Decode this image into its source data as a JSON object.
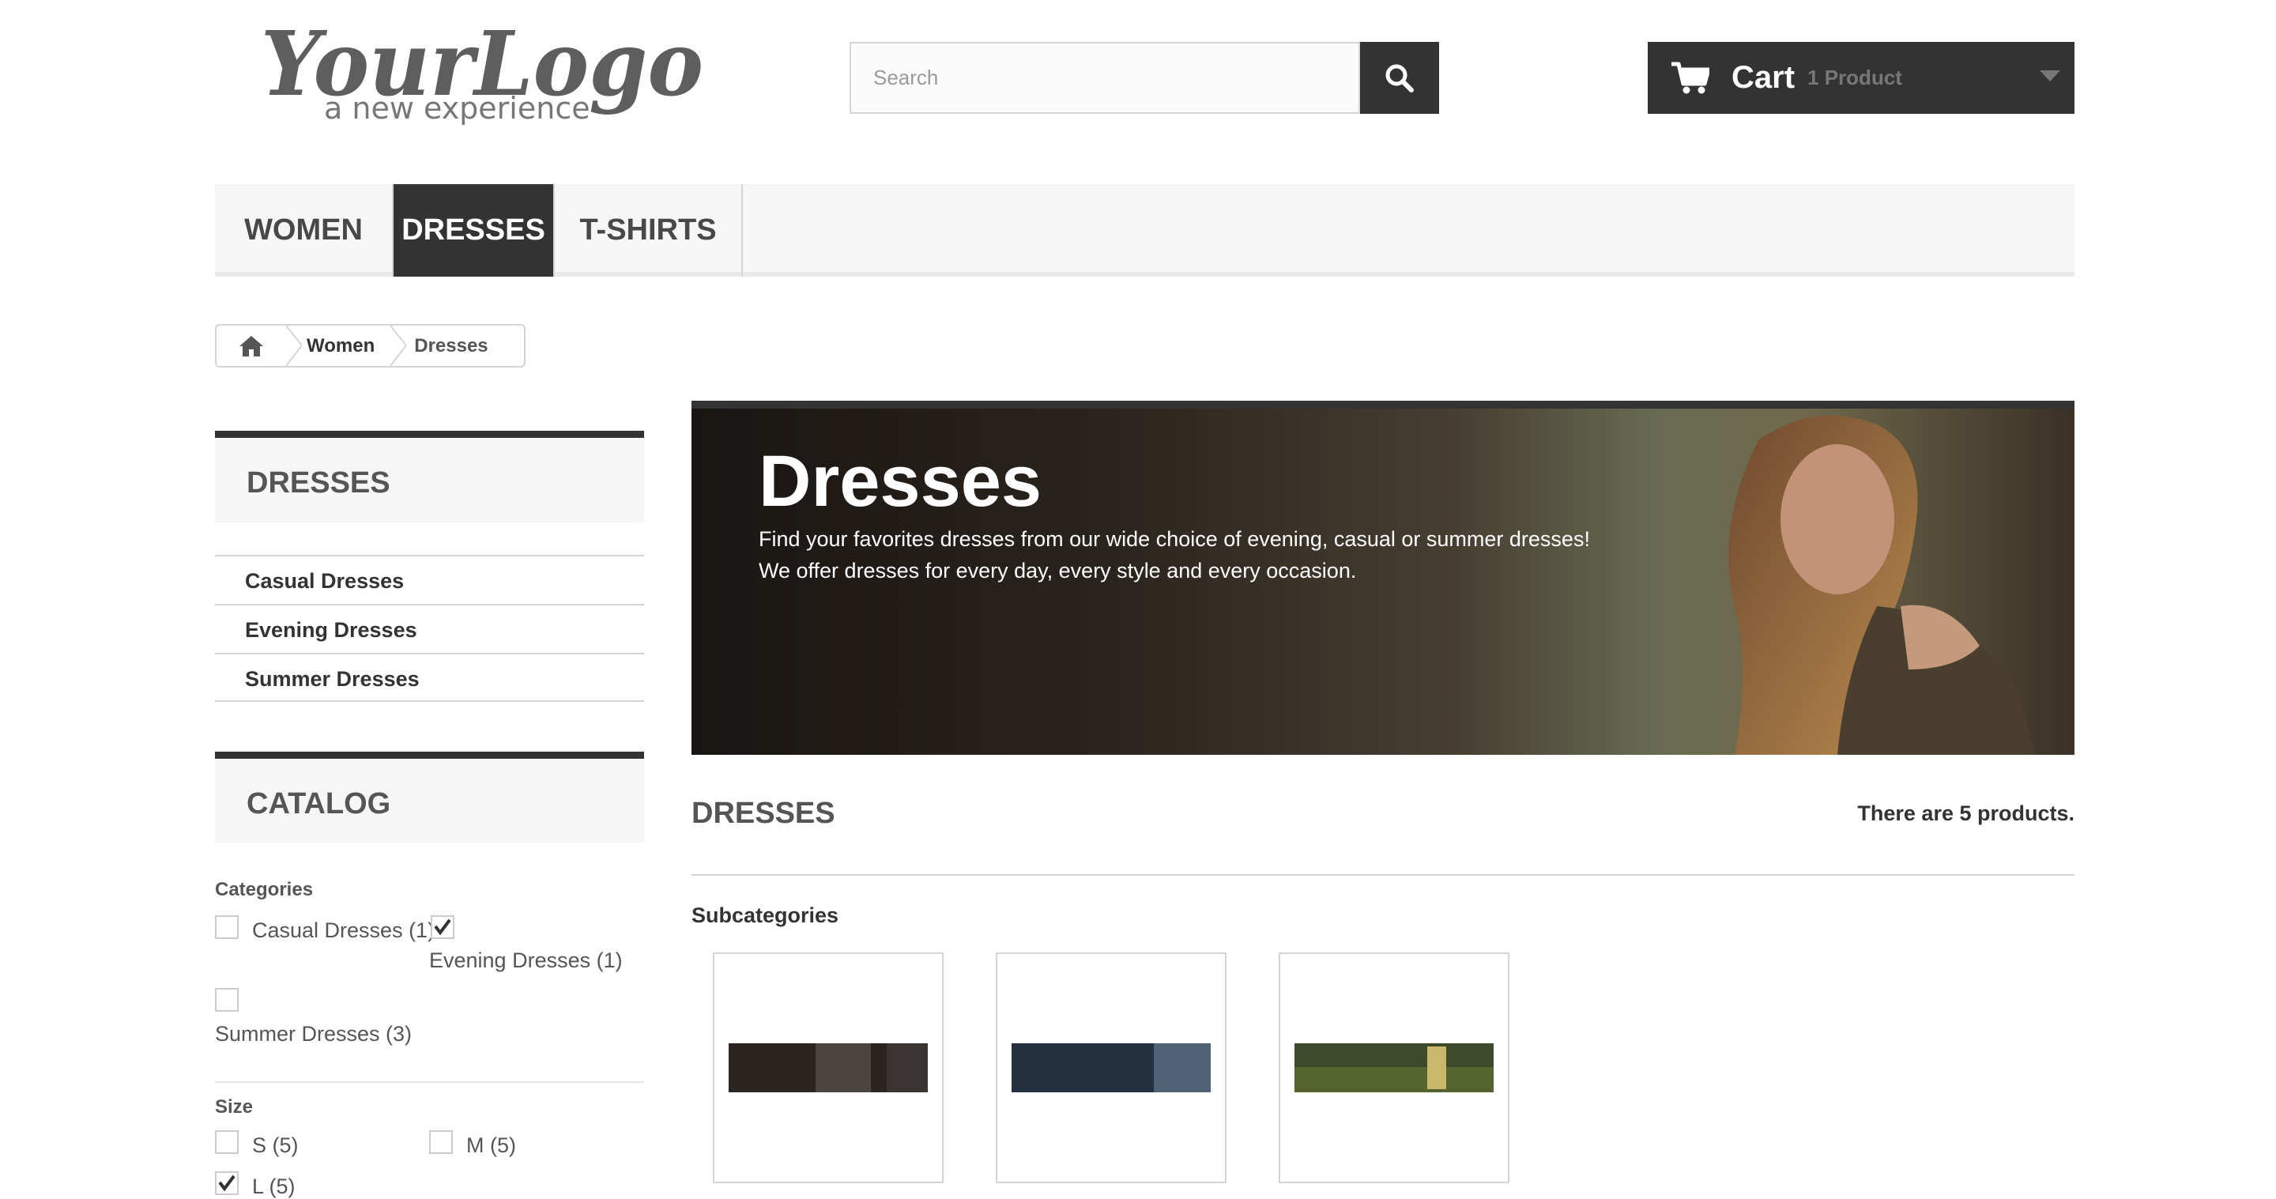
{
  "header": {
    "logo": {
      "main_text": "YourLogo",
      "tagline": "a new experience"
    },
    "search": {
      "placeholder": "Search",
      "button_icon": "search-icon"
    },
    "cart": {
      "label": "Cart",
      "quantity_text": "1 Product",
      "icon": "shopping-cart-icon"
    }
  },
  "menu": {
    "items": [
      "WOMEN",
      "DRESSES",
      "T-SHIRTS"
    ],
    "active": "DRESSES"
  },
  "breadcrumb": {
    "home_icon": "home-icon",
    "items": [
      "Women",
      "Dresses"
    ]
  },
  "sidebar": {
    "category_block": {
      "title": "DRESSES",
      "subcategories": [
        "Casual Dresses",
        "Evening Dresses",
        "Summer Dresses"
      ]
    },
    "catalog_block": {
      "title": "CATALOG",
      "categories": {
        "heading": "Categories",
        "options": [
          {
            "label": "Casual Dresses (1)",
            "checked": false
          },
          {
            "label": "Evening Dresses (1)",
            "checked": true
          },
          {
            "label": "Summer Dresses (3)",
            "checked": false
          }
        ]
      },
      "size": {
        "heading": "Size",
        "options": [
          {
            "label": "S (5)",
            "checked": false
          },
          {
            "label": "M (5)",
            "checked": false
          },
          {
            "label": "L (5)",
            "checked": true
          }
        ]
      }
    }
  },
  "banner": {
    "title": "Dresses",
    "description_line1": "Find your favorites dresses from our wide choice of evening, casual or summer dresses!",
    "description_line2": "We offer dresses for every day, every style and every occasion."
  },
  "listing": {
    "title": "DRESSES",
    "product_count": "There are 5 products.",
    "subcategories_heading": "Subcategories"
  },
  "colors": {
    "dark": "#333333",
    "menu_bg": "#f6f6f6",
    "border": "#d6d4d4"
  }
}
